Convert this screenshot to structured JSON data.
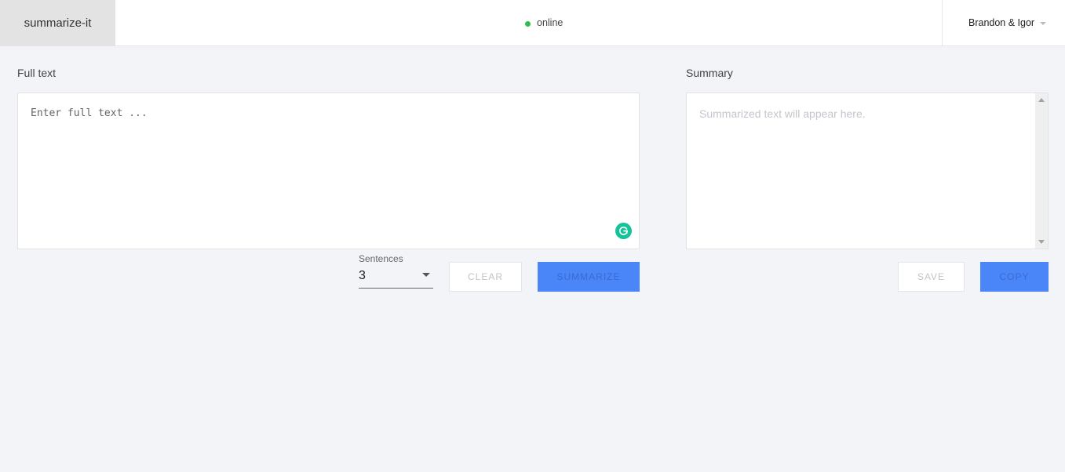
{
  "header": {
    "brand": "summarize-it",
    "status_text": "online",
    "user_name": "Brandon & Igor"
  },
  "colors": {
    "status_online": "#2ebd4f",
    "primary_button": "#4a86f7",
    "grammarly": "#15c39a"
  },
  "full_text": {
    "label": "Full text",
    "placeholder": "Enter full text ...",
    "value": ""
  },
  "summary": {
    "label": "Summary",
    "placeholder": "Summarized text will appear here."
  },
  "sentences": {
    "label": "Sentences",
    "selected": "3"
  },
  "buttons": {
    "clear": "CLEAR",
    "summarize": "SUMMARIZE",
    "save": "SAVE",
    "copy": "COPY"
  },
  "icons": {
    "status": "status-dot-icon",
    "user_menu": "chevron-down-icon",
    "grammarly": "grammarly-icon",
    "select": "caret-down-icon"
  }
}
